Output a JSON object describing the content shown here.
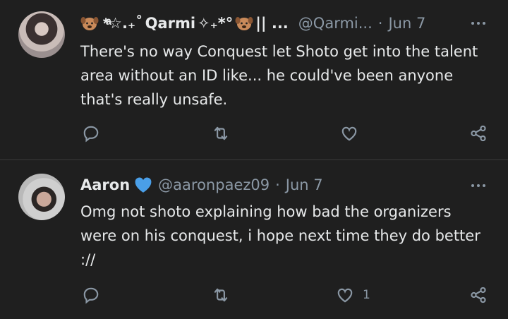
{
  "tweets": [
    {
      "display_name": "Qarmi",
      "name_prefix_symbols": "*ͣ☆.₊˚",
      "name_suffix_symbols": "✧₊*°",
      "truncation": "|| ...",
      "handle": "@Qarmi...",
      "separator": "·",
      "date": "Jun 7",
      "text": "There's no way Conquest let Shoto get into the talent area without an ID like... he could've been anyone that's really unsafe.",
      "like_count": ""
    },
    {
      "display_name": "Aaron",
      "handle": "@aaronpaez09",
      "separator": "·",
      "date": "Jun 7",
      "text": "Omg not shoto explaining how bad the organizers were on his conquest, i hope next time they do better ://",
      "like_count": "1"
    }
  ],
  "colors": {
    "background": "#1f1f1f",
    "text": "#e7e9ea",
    "muted": "#8b98a5",
    "verified": "#4a9fe8",
    "divider": "#3a3a3a"
  },
  "icons": [
    "more-icon",
    "reply-icon",
    "retweet-icon",
    "like-icon",
    "share-icon",
    "dog-emoji-icon",
    "blue-heart-icon"
  ]
}
